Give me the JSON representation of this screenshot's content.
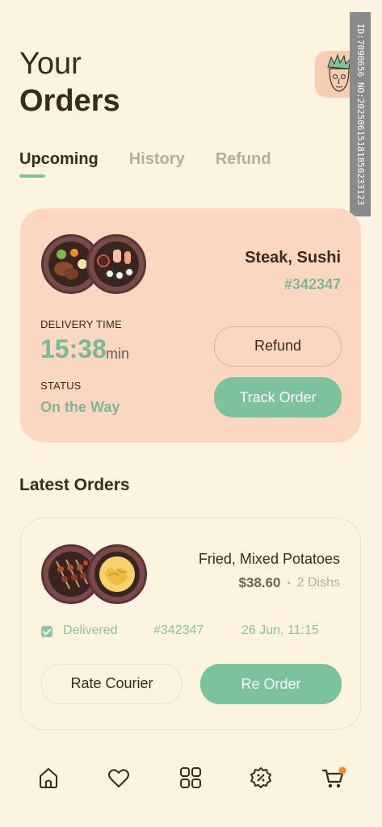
{
  "header": {
    "title_line1": "Your",
    "title_line2": "Orders"
  },
  "watermark": "ID:7090656 NO:20250615181850233123",
  "tabs": [
    {
      "label": "Upcoming",
      "active": true
    },
    {
      "label": "History",
      "active": false
    },
    {
      "label": "Refund",
      "active": false
    }
  ],
  "current_order": {
    "dish_name": "Steak, Sushi",
    "order_number": "#342347",
    "delivery_label": "DELIVERY TIME",
    "delivery_time": "15:38",
    "delivery_unit": "min",
    "status_label": "STATUS",
    "status_value": "On the Way",
    "refund_label": "Refund",
    "track_label": "Track Order"
  },
  "latest": {
    "section_title": "Latest Orders",
    "dish_name": "Fried, Mixed Potatoes",
    "price": "$38.60",
    "separator": "•",
    "dish_count": "2 Dishs",
    "status": "Delivered",
    "order_number": "#342347",
    "date": "26 Jun, 11:15",
    "rate_label": "Rate Courier",
    "reorder_label": "Re Order"
  },
  "nav": {
    "items": [
      "home-icon",
      "heart-icon",
      "grid-icon",
      "discount-icon",
      "cart-icon"
    ],
    "accent": "#f08c2a"
  },
  "colors": {
    "background": "#fdf3e1",
    "accent_green": "#7cc29c",
    "card_peach": "#fbd7c2",
    "text_dark": "#3a2a1e"
  }
}
